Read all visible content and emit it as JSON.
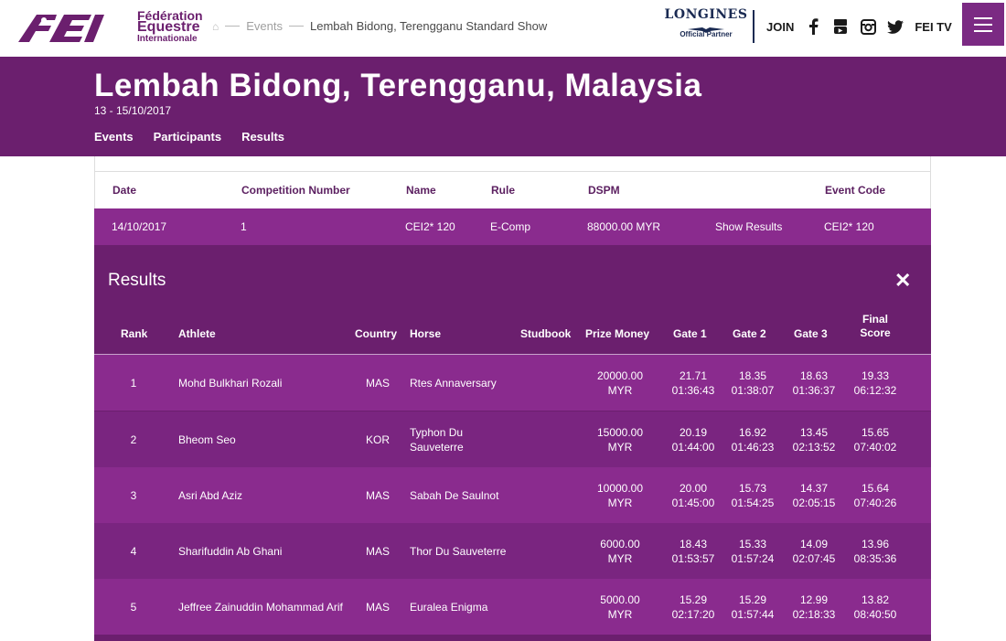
{
  "header_bar": {
    "logo_alt": "FEI",
    "org_line1": "Fédération",
    "org_line2": "Equestre",
    "org_line3": "Internationale",
    "breadcrumb": [
      "Events",
      "Lembah Bidong, Terengganu Standard Show"
    ],
    "sponsor_brand": "LONGINES",
    "sponsor_tag": "Official Partner",
    "join_label": "JOIN",
    "social": [
      "facebook-icon",
      "youtube-icon",
      "instagram-icon",
      "twitter-icon"
    ],
    "fei_tv_label": "FEI TV"
  },
  "event": {
    "title": "Lembah Bidong, Terengganu, Malaysia",
    "dates": "13 - 15/10/2017",
    "tabs": [
      "Events",
      "Participants",
      "Results"
    ]
  },
  "competition": {
    "headers": {
      "date": "Date",
      "number": "Competition Number",
      "name": "Name",
      "rule": "Rule",
      "dspm": "DSPM",
      "code": "Event Code"
    },
    "row": {
      "date": "14/10/2017",
      "number": "1",
      "name": "CEI2* 120",
      "rule": "E-Comp",
      "dspm": "88000.00 MYR",
      "action": "Show Results",
      "code": "CEI2* 120"
    }
  },
  "results": {
    "title": "Results",
    "close": "✕",
    "headers": {
      "rank": "Rank",
      "athlete": "Athlete",
      "country": "Country",
      "horse": "Horse",
      "studbook": "Studbook",
      "prize": "Prize Money",
      "gate1": "Gate 1",
      "gate2": "Gate 2",
      "gate3": "Gate 3",
      "final_a": "Final",
      "final_b": "Score"
    },
    "rows": [
      {
        "rank": "1",
        "athlete": "Mohd Bulkhari Rozali",
        "country": "MAS",
        "horse": "Rtes Annaversary",
        "studbook": "",
        "prize_a": "20000.00",
        "prize_b": "MYR",
        "g1a": "21.71",
        "g1b": "01:36:43",
        "g2a": "18.35",
        "g2b": "01:38:07",
        "g3a": "18.63",
        "g3b": "01:36:37",
        "fa": "19.33",
        "fb": "06:12:32"
      },
      {
        "rank": "2",
        "athlete": "Bheom Seo",
        "country": "KOR",
        "horse": "Typhon Du Sauveterre",
        "studbook": "",
        "prize_a": "15000.00",
        "prize_b": "MYR",
        "g1a": "20.19",
        "g1b": "01:44:00",
        "g2a": "16.92",
        "g2b": "01:46:23",
        "g3a": "13.45",
        "g3b": "02:13:52",
        "fa": "15.65",
        "fb": "07:40:02"
      },
      {
        "rank": "3",
        "athlete": "Asri Abd Aziz",
        "country": "MAS",
        "horse": "Sabah De Saulnot",
        "studbook": "",
        "prize_a": "10000.00",
        "prize_b": "MYR",
        "g1a": "20.00",
        "g1b": "01:45:00",
        "g2a": "15.73",
        "g2b": "01:54:25",
        "g3a": "14.37",
        "g3b": "02:05:15",
        "fa": "15.64",
        "fb": "07:40:26"
      },
      {
        "rank": "4",
        "athlete": "Sharifuddin Ab Ghani",
        "country": "MAS",
        "horse": "Thor Du Sauveterre",
        "studbook": "",
        "prize_a": "6000.00",
        "prize_b": "MYR",
        "g1a": "18.43",
        "g1b": "01:53:57",
        "g2a": "15.33",
        "g2b": "01:57:24",
        "g3a": "14.09",
        "g3b": "02:07:45",
        "fa": "13.96",
        "fb": "08:35:36"
      },
      {
        "rank": "5",
        "athlete": "Jeffree Zainuddin Mohammad Arif",
        "country": "MAS",
        "horse": "Euralea Enigma",
        "studbook": "",
        "prize_a": "5000.00",
        "prize_b": "MYR",
        "g1a": "15.29",
        "g1b": "02:17:20",
        "g2a": "15.29",
        "g2b": "01:57:44",
        "g3a": "12.99",
        "g3b": "02:18:33",
        "fa": "13.82",
        "fb": "08:40:50"
      }
    ]
  },
  "colors": {
    "brand_purple": "#6b1f6e",
    "row_light": "#8a2b8e",
    "row_dark": "#7a2580"
  }
}
